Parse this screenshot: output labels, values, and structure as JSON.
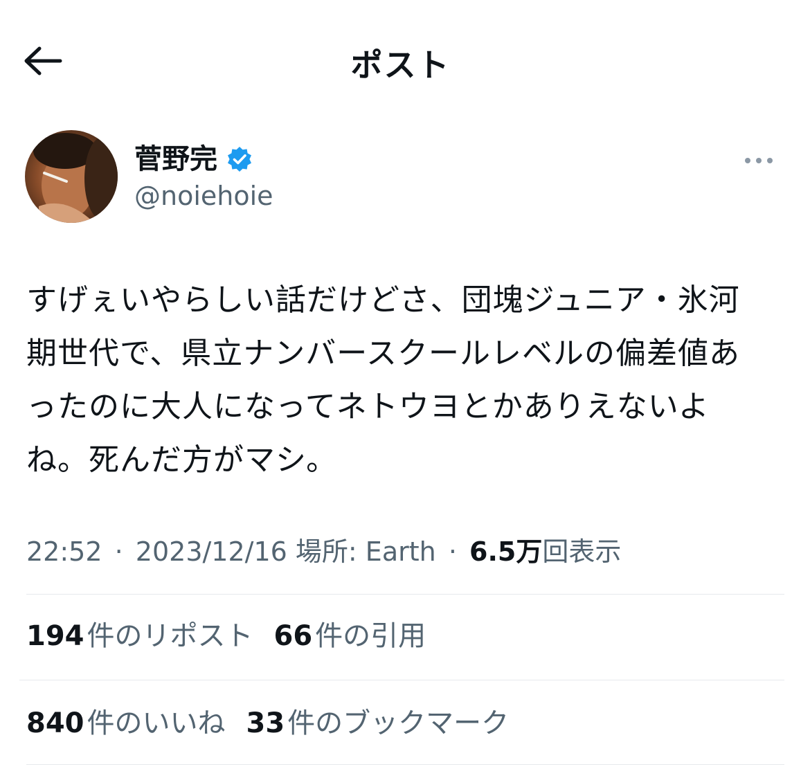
{
  "header": {
    "title": "ポスト",
    "back_icon": "arrow-left-icon"
  },
  "author": {
    "display_name": "菅野完",
    "handle": "@noiehoie",
    "verified": true,
    "verified_color": "#1d9bf0",
    "more_icon": "ellipsis-icon"
  },
  "tweet": {
    "lines": [
      "すげぇいやらしい話だけどさ、団塊ジュニア・氷河",
      "期世代で、県立ナンバースクールレベルの偏差値あ",
      "ったのに大人になってネトウヨとかありえないよ",
      "ね。死んだ方がマシ。"
    ]
  },
  "meta": {
    "time": "22:52",
    "separator": "·",
    "date": "2023/12/16",
    "location_label": "場所: Earth",
    "views_count": "6.5万",
    "views_label": "回表示"
  },
  "stats": {
    "reposts_count": "194",
    "reposts_label": "件のリポスト",
    "quotes_count": "66",
    "quotes_label": "件の引用",
    "likes_count": "840",
    "likes_label": "件のいいね",
    "bookmarks_count": "33",
    "bookmarks_label": "件のブックマーク"
  },
  "colors": {
    "text_primary": "#0f1419",
    "text_secondary": "#536471",
    "divider": "#e6e9ec"
  }
}
